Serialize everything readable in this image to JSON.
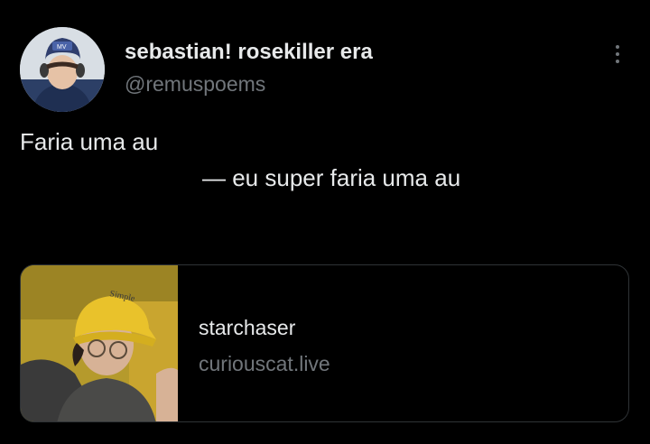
{
  "post": {
    "author": {
      "display_name": "sebastian! rosekiller era",
      "handle": "@remuspoems"
    },
    "text_line_1": "Faria uma au",
    "text_line_2": "— eu super faria uma au",
    "link_card": {
      "title": "starchaser",
      "domain": "curiouscat.live"
    }
  },
  "icons": {
    "more": "more-vertical-icon"
  },
  "colors": {
    "background": "#000000",
    "primary_text": "#e7e9ea",
    "secondary_text": "#71767b",
    "card_border": "#2f3336",
    "cap_yellow": "#e9c22b"
  }
}
